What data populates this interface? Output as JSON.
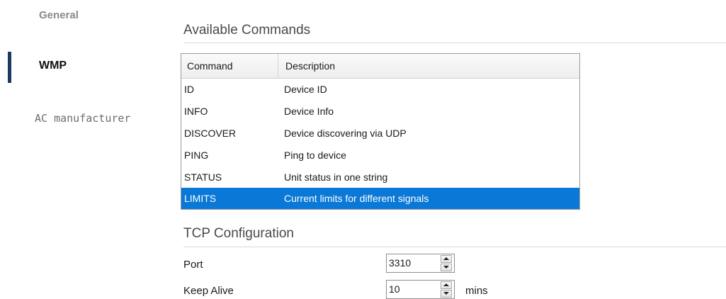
{
  "sidebar": {
    "items": [
      {
        "label": "General"
      },
      {
        "label": "WMP"
      },
      {
        "label": "AC manufacturer"
      }
    ]
  },
  "available_commands": {
    "title": "Available Commands",
    "columns": [
      "Command",
      "Description"
    ],
    "rows": [
      {
        "command": "ID",
        "description": "Device ID"
      },
      {
        "command": "INFO",
        "description": "Device Info"
      },
      {
        "command": "DISCOVER",
        "description": "Device discovering via UDP"
      },
      {
        "command": "PING",
        "description": "Ping to device"
      },
      {
        "command": "STATUS",
        "description": "Unit status in one string"
      },
      {
        "command": "LIMITS",
        "description": "Current limits for different signals"
      }
    ],
    "selected_row": "LIMITS",
    "selection_color": "#0a78d7"
  },
  "tcp": {
    "title": "TCP Configuration",
    "port_label": "Port",
    "port_value": "3310",
    "keepalive_label": "Keep Alive",
    "keepalive_value": "10",
    "keepalive_unit": "mins"
  },
  "colors": {
    "accent_bar": "#1c3a5e"
  },
  "icons": {
    "spin_up": "spin-up-icon",
    "spin_down": "spin-down-icon"
  }
}
